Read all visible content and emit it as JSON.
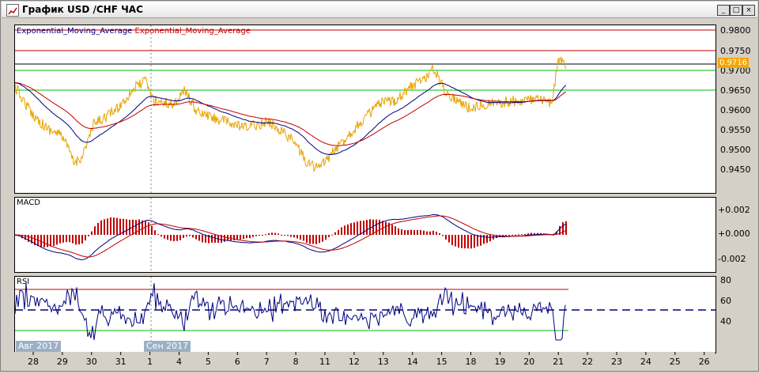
{
  "window": {
    "title": "График USD /CHF ЧАС",
    "buttons": [
      "_",
      "□",
      "×"
    ]
  },
  "price_pane": {
    "legend_blue": "Exponential_Moving_Average",
    "legend_red": "Exponential_Moving_Average",
    "current_price": "0.9716",
    "ticks": [
      "0.9800",
      "0.9750",
      "0.9700",
      "0.9650",
      "0.9600",
      "0.9550",
      "0.9500",
      "0.9450"
    ]
  },
  "macd_pane": {
    "label": "MACD",
    "ticks": [
      "+0.002",
      "+0.000",
      "-0.002"
    ]
  },
  "rsi_pane": {
    "label": "RSI",
    "ticks": [
      "80",
      "60",
      "40"
    ]
  },
  "x_axis": {
    "ticks": [
      "28",
      "29",
      "30",
      "31",
      "1",
      "4",
      "5",
      "6",
      "7",
      "8",
      "11",
      "12",
      "13",
      "14",
      "15",
      "18",
      "19",
      "20",
      "21",
      "22",
      "23",
      "24",
      "25",
      "26"
    ],
    "month_labels": [
      "Авг 2017",
      "Сен 2017"
    ]
  },
  "colors": {
    "price_series": "#e8a200",
    "ema_fast": "#00007f",
    "ema_slow": "#c00000",
    "macd_hist": "#c00000",
    "rsi_line": "#00007f",
    "rsi_upper": "#c00000",
    "rsi_lower": "#00c000",
    "support": "#00c000",
    "resistance": "#c00000",
    "window_bg": "#d4d0c8"
  }
}
